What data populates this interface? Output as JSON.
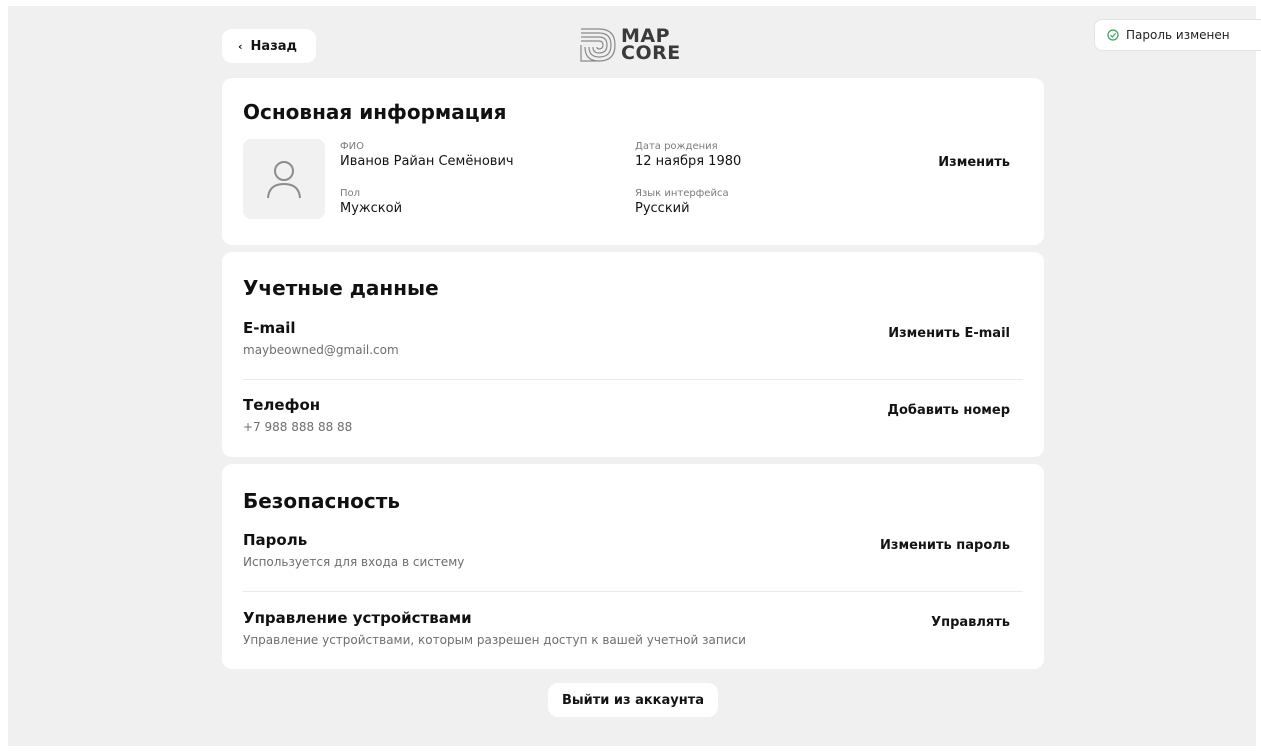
{
  "header": {
    "back_label": "Назад",
    "logo_line1": "MAP",
    "logo_line2": "CORE"
  },
  "toast": {
    "text": "Пароль изменен",
    "status_color": "#3aa757"
  },
  "basic_info": {
    "title": "Основная информация",
    "fio_label": "ФИО",
    "fio_value": "Иванов Райан Семёнович",
    "gender_label": "Пол",
    "gender_value": "Мужской",
    "birth_label": "Дата рождения",
    "birth_value": "12 наября 1980",
    "lang_label": "Язык интерфейса",
    "lang_value": "Русский",
    "edit_label": "Изменить"
  },
  "credentials": {
    "title": "Учетные данные",
    "email_title": "E-mail",
    "email_value": "maybeowned@gmail.com",
    "email_action": "Изменить E-mail",
    "phone_title": "Телефон",
    "phone_value": "+7 988 888 88 88",
    "phone_action": "Добавить номер"
  },
  "security": {
    "title": "Безопасность",
    "password_title": "Пароль",
    "password_desc": "Используется для входа в систему",
    "password_action": "Изменить пароль",
    "devices_title": "Управление устройствами",
    "devices_desc": "Управление устройствами, которым разрешен доступ к вашей учетной записи",
    "devices_action": "Управлять"
  },
  "logout_label": "Выйти из аккаунта"
}
